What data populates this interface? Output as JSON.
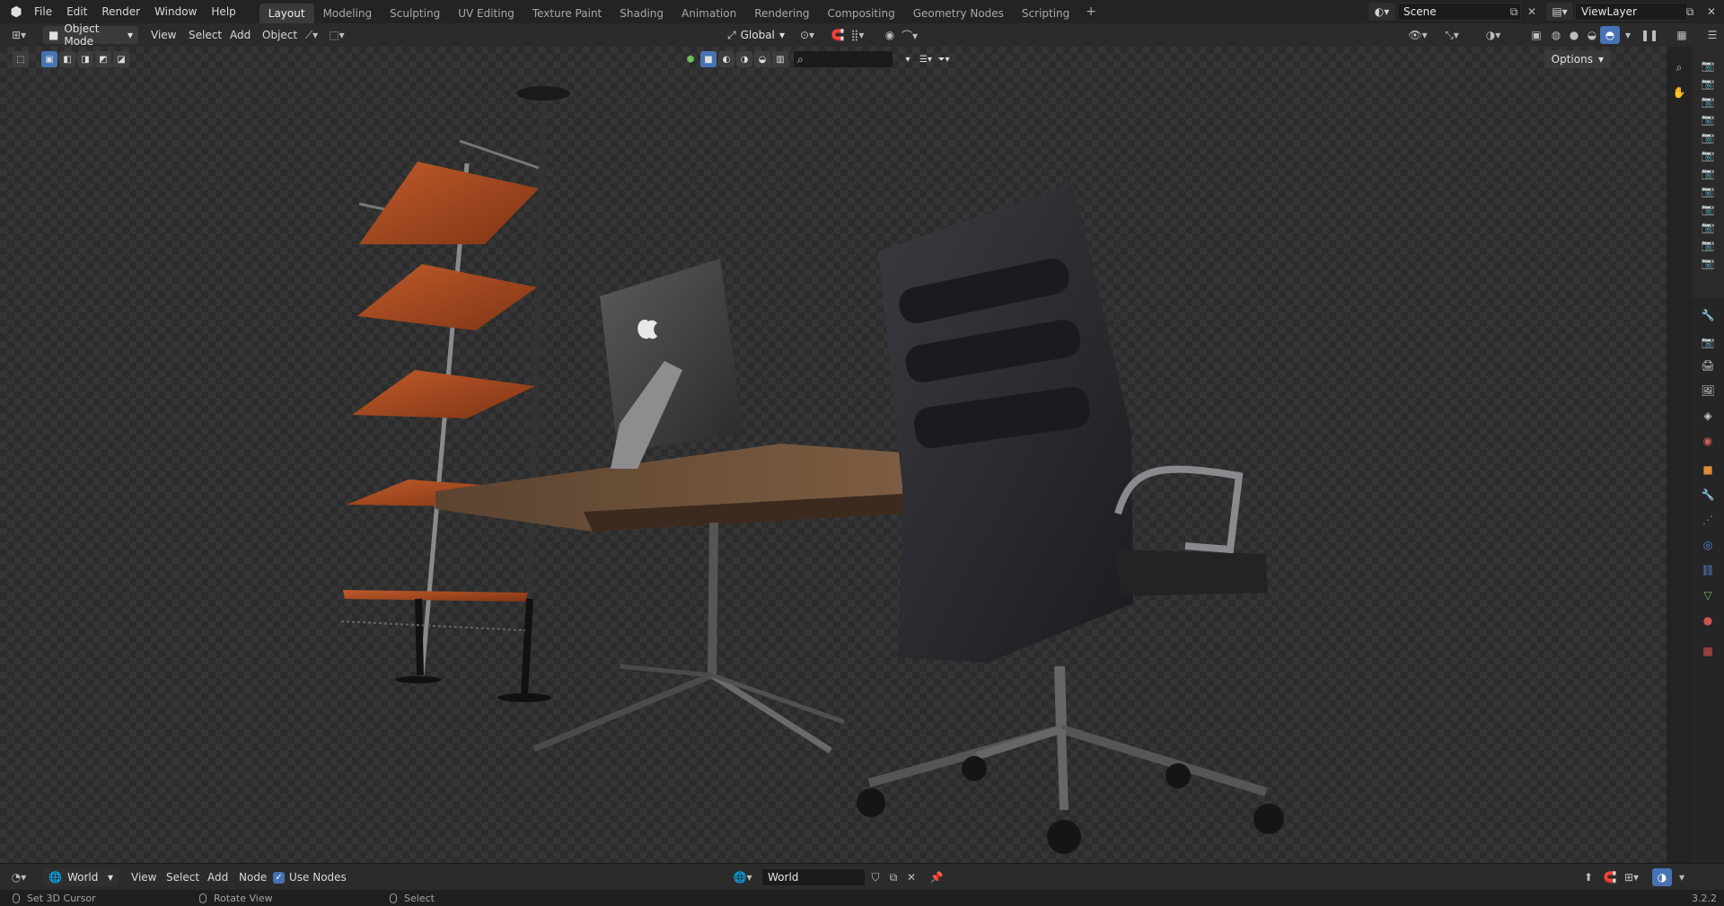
{
  "app": {
    "logo_icon": "blender-logo-icon"
  },
  "menu": [
    "File",
    "Edit",
    "Render",
    "Window",
    "Help"
  ],
  "workspaces": [
    "Layout",
    "Modeling",
    "Sculpting",
    "UV Editing",
    "Texture Paint",
    "Shading",
    "Animation",
    "Rendering",
    "Compositing",
    "Geometry Nodes",
    "Scripting"
  ],
  "active_workspace": "Layout",
  "scene": {
    "name": "Scene"
  },
  "view_layer": {
    "name": "ViewLayer"
  },
  "viewport_header": {
    "mode": "Object Mode",
    "menus": [
      "View",
      "Select",
      "Add",
      "Object"
    ],
    "transform_orientation": "Global",
    "options_label": "Options"
  },
  "world_header": {
    "editor_icon": "world-shader-icon",
    "data_type": "World",
    "menus": [
      "View",
      "Select",
      "Add",
      "Node"
    ],
    "use_nodes_label": "Use Nodes",
    "use_nodes_checked": true,
    "world_name": "World"
  },
  "statusbar": {
    "left": "Set 3D Cursor",
    "middle": "Rotate View",
    "right": "Select",
    "version": "3.2.2"
  },
  "colors": {
    "accent": "#4772b3",
    "shelf_wood": "#b9562a",
    "desk_wood": "#6b4a32",
    "chair": "#2a2a2e"
  }
}
